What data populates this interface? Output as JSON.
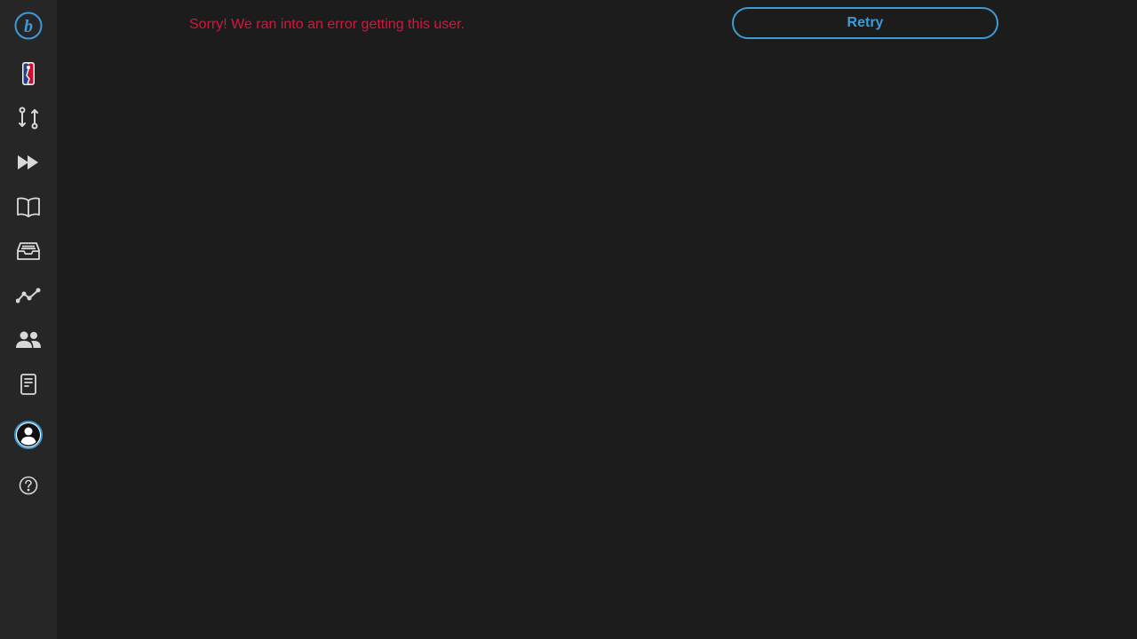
{
  "sidebar": {
    "accent_color": "#3d9cd8",
    "icon_color": "#d8d8d8",
    "items": [
      {
        "name": "logo",
        "icon": "logo-b-icon"
      },
      {
        "name": "nba",
        "icon": "nba-logo-icon"
      },
      {
        "name": "trades",
        "icon": "swap-arrows-icon"
      },
      {
        "name": "fast-forward",
        "icon": "fast-forward-icon"
      },
      {
        "name": "guide",
        "icon": "open-book-icon"
      },
      {
        "name": "inbox",
        "icon": "inbox-tray-icon"
      },
      {
        "name": "trends",
        "icon": "line-chart-icon"
      },
      {
        "name": "users",
        "icon": "users-icon"
      },
      {
        "name": "notes",
        "icon": "document-icon"
      },
      {
        "name": "profile",
        "icon": "user-avatar-icon"
      },
      {
        "name": "help",
        "icon": "question-circle-icon"
      }
    ]
  },
  "main": {
    "error_message": "Sorry! We ran into an error getting this user.",
    "error_color": "#d0193e",
    "retry_label": "Retry"
  }
}
